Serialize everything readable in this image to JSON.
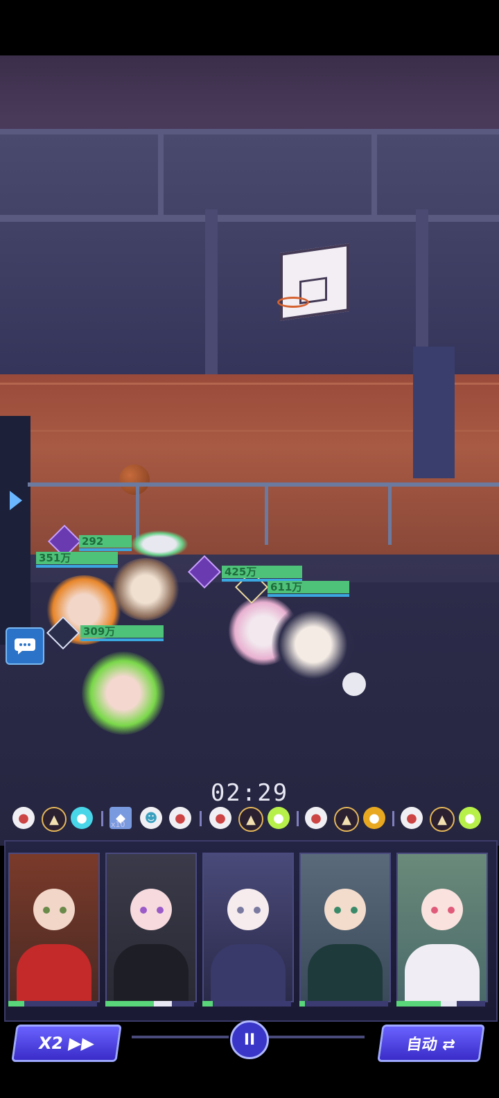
{
  "battle": {
    "timer": "02:29",
    "hp_labels": [
      "292",
      "351万",
      "309万",
      "425万",
      "611万"
    ]
  },
  "skill_queue": {
    "x10_label": "x10",
    "icons": [
      "white-orb",
      "tree",
      "cyan-orb",
      "crystal",
      "ghost",
      "white-orb",
      "white-orb",
      "tree",
      "green-orb",
      "white-orb",
      "tree",
      "gold-orb",
      "white-orb",
      "tree",
      "green-orb"
    ]
  },
  "party": {
    "cards": [
      {
        "name": "reindeer-girl",
        "energy": 0.18,
        "energy2": 0
      },
      {
        "name": "pink-hair-girl",
        "energy": 0.55,
        "energy2": 0.2
      },
      {
        "name": "white-hair-girl",
        "energy": 0.12,
        "energy2": 0
      },
      {
        "name": "orange-hair-girl",
        "energy": 0.06,
        "energy2": 0
      },
      {
        "name": "green-hair-girl",
        "energy": 0.5,
        "energy2": 0.18
      }
    ]
  },
  "controls": {
    "speed_label": "X2 ▶▶",
    "pause_label": "II",
    "auto_label": "自动 ⇄"
  },
  "colors": {
    "hp": "#4fc27a",
    "button": "#4a3ed8",
    "accent": "#6ab7ff"
  }
}
